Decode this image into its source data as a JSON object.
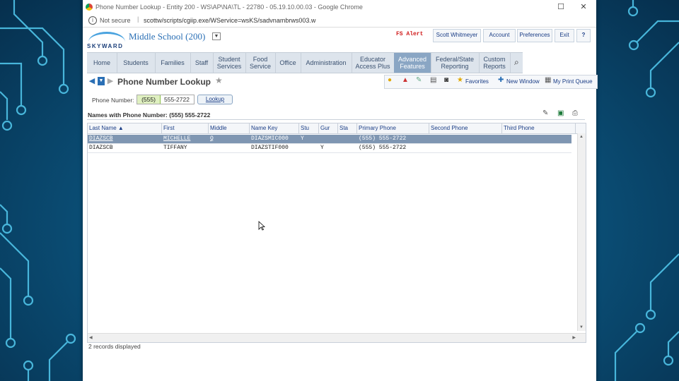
{
  "window": {
    "title": "Phone Number Lookup - Entity 200 - WS\\AP\\NA\\TL - 22780 - 05.19.10.00.03 - Google Chrome",
    "minimize": "☐",
    "close": "✕"
  },
  "address_bar": {
    "security": "Not secure",
    "url": "scottw/scripts/cgiip.exe/WService=wsKS/sadvnambrws003.w"
  },
  "header": {
    "logo_text": "SKYWARD",
    "school": "Middle School (200)",
    "alert": "FS Alert",
    "links": [
      "Scott Whitmeyer",
      "Account",
      "Preferences",
      "Exit",
      "?"
    ]
  },
  "nav": {
    "items": [
      {
        "label": "Home",
        "active": false
      },
      {
        "label": "Students",
        "active": false
      },
      {
        "label": "Families",
        "active": false
      },
      {
        "label": "Staff",
        "active": false
      },
      {
        "label": "Student Services",
        "active": false
      },
      {
        "label": "Food Service",
        "active": false
      },
      {
        "label": "Office",
        "active": false
      },
      {
        "label": "Administration",
        "active": false
      },
      {
        "label": "Educator Access Plus",
        "active": false
      },
      {
        "label": "Advanced Features",
        "active": true
      },
      {
        "label": "Federal/State Reporting",
        "active": false
      },
      {
        "label": "Custom Reports",
        "active": false
      }
    ]
  },
  "page": {
    "title": "Phone Number Lookup",
    "toolbar": {
      "favorites": "Favorites",
      "new_window": "New Window",
      "print_queue": "My Print Queue"
    }
  },
  "lookup": {
    "label": "Phone Number:",
    "area_code": "(555)",
    "number": "555-2722",
    "button": "Lookup"
  },
  "results": {
    "heading": "Names with Phone Number: (555) 555-2722",
    "columns": [
      "Last Name ▲",
      "First",
      "Middle",
      "Name Key",
      "Stu",
      "Gur",
      "Sta",
      "Primary Phone",
      "Second Phone",
      "Third Phone"
    ],
    "rows": [
      [
        "DIAZSCB",
        "MICHELLE",
        "Q",
        "DIAZSMIC000",
        "Y",
        "",
        "",
        "(555) 555-2722",
        "",
        ""
      ],
      [
        "DIAZSCB",
        "TIFFANY",
        "",
        "DIAZSTIF000",
        "",
        "Y",
        "",
        "(555) 555-2722",
        "",
        ""
      ]
    ],
    "footer": "2 records displayed"
  },
  "colors": {
    "active_nav": "#8aa6c4",
    "selected_row": "#7f96b2",
    "link_blue": "#1a3d86",
    "alert_red": "#d01b1b"
  }
}
